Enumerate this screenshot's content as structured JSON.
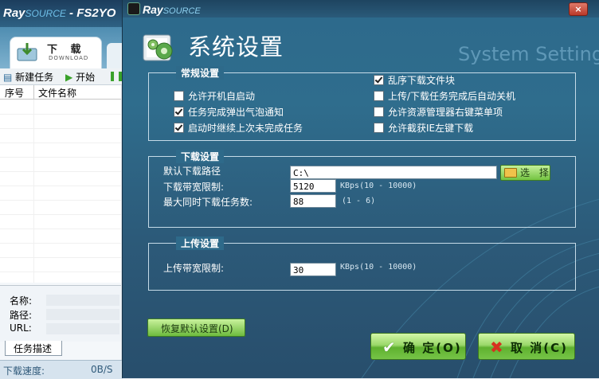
{
  "background_window": {
    "logo_ray": "Ray",
    "logo_source": "SOURCE",
    "title": "- FS2YO",
    "tab_download_title": "下 载",
    "tab_download_sub": "DOWNLOAD",
    "toolbar": {
      "new_task": "新建任务",
      "start": "开始"
    },
    "table_headers": [
      "序号",
      "文件名称"
    ],
    "details": {
      "name_label": "名称:",
      "path_label": "路径:",
      "url_label": "URL:"
    },
    "task_tab": "任务描述",
    "status": {
      "speed_label": "下载速度:",
      "speed_value": "0B/S"
    }
  },
  "dialog": {
    "logo_ray": "Ray",
    "logo_source": "SOURCE",
    "close": "×",
    "title": "系统设置",
    "title_en": "System Setting",
    "general": {
      "title": "常规设置",
      "options_left": [
        {
          "label": "允许开机自启动",
          "checked": false
        },
        {
          "label": "任务完成弹出气泡通知",
          "checked": true
        },
        {
          "label": "启动时继续上次未完成任务",
          "checked": true
        }
      ],
      "options_right": [
        {
          "label": "乱序下载文件块",
          "checked": true
        },
        {
          "label": "上传/下载任务完成后自动关机",
          "checked": false
        },
        {
          "label": "允许资源管理器右键菜单项",
          "checked": false
        },
        {
          "label": "允许截获IE左键下载",
          "checked": false
        }
      ]
    },
    "download": {
      "title": "下载设置",
      "path_label": "默认下载路径",
      "path_value": "C:\\",
      "browse_label": "选 择",
      "bandwidth_label": "下载带宽限制:",
      "bandwidth_value": "5120",
      "bandwidth_hint": "KBps(10 - 10000)",
      "max_tasks_label": "最大同时下载任务数:",
      "max_tasks_value": "88",
      "max_tasks_hint": "(1 - 6)"
    },
    "upload": {
      "title": "上传设置",
      "bandwidth_label": "上传带宽限制:",
      "bandwidth_value": "30",
      "bandwidth_hint": "KBps(10 - 10000)"
    },
    "restore_label": "恢复默认设置(D)",
    "ok_label": "确 定(O)",
    "cancel_label": "取 消(C)"
  }
}
